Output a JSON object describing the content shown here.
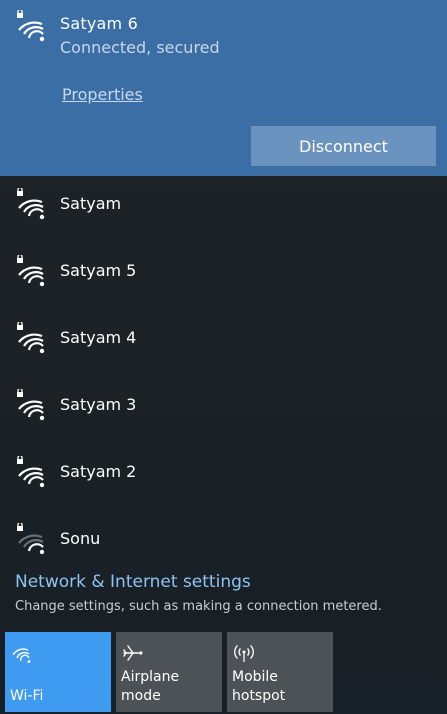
{
  "connected": {
    "name": "Satyam  6",
    "status": "Connected, secured",
    "properties_label": "Properties",
    "disconnect_label": "Disconnect",
    "icon": "wifi-secured-icon"
  },
  "networks": [
    {
      "name": "Satyam",
      "icon": "wifi-secured-icon"
    },
    {
      "name": "Satyam  5",
      "icon": "wifi-secured-icon"
    },
    {
      "name": "Satyam  4",
      "icon": "wifi-secured-icon"
    },
    {
      "name": "Satyam  3",
      "icon": "wifi-secured-icon"
    },
    {
      "name": "Satyam  2",
      "icon": "wifi-secured-icon"
    },
    {
      "name": "Sonu",
      "icon": "wifi-secured-weak-icon"
    }
  ],
  "settings": {
    "link_label": "Network & Internet settings",
    "description": "Change settings, such as making a connection metered."
  },
  "quick_actions": [
    {
      "label": "Wi-Fi",
      "icon": "wifi-icon",
      "active": true
    },
    {
      "label": "Airplane mode",
      "icon": "airplane-icon",
      "active": false
    },
    {
      "label": "Mobile\nhotspot",
      "icon": "hotspot-icon",
      "active": false
    }
  ],
  "colors": {
    "accent": "#3f9bf2",
    "connected_bg": "#3a6ea5",
    "link": "#8fc3f2"
  }
}
